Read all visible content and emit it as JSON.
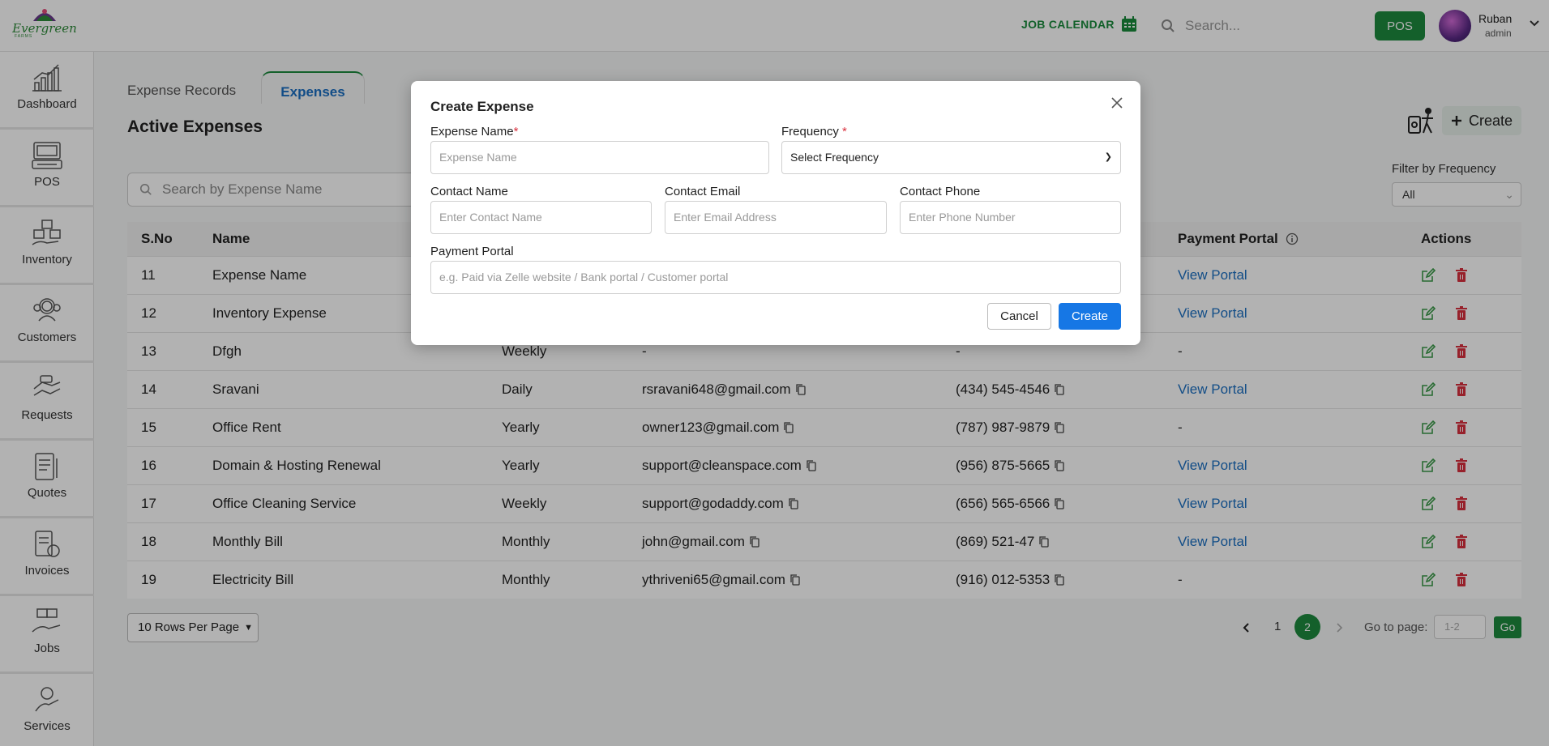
{
  "brand": {
    "name": "Evergreen",
    "sub": "FARMS"
  },
  "topbar": {
    "job_calendar": "JOB CALENDAR",
    "search_placeholder": "Search...",
    "pos_label": "POS",
    "user_name": "Ruban",
    "user_role": "admin"
  },
  "sidebar": {
    "items": [
      {
        "label": "Dashboard",
        "icon": "dashboard-icon"
      },
      {
        "label": "POS",
        "icon": "pos-icon"
      },
      {
        "label": "Inventory",
        "icon": "inventory-icon"
      },
      {
        "label": "Customers",
        "icon": "customers-icon"
      },
      {
        "label": "Requests",
        "icon": "requests-icon"
      },
      {
        "label": "Quotes",
        "icon": "quotes-icon"
      },
      {
        "label": "Invoices",
        "icon": "invoices-icon"
      },
      {
        "label": "Jobs",
        "icon": "jobs-icon"
      },
      {
        "label": "Services",
        "icon": "services-icon"
      }
    ]
  },
  "tabs": {
    "records": "Expense Records",
    "expenses": "Expenses"
  },
  "page_title": "Active Expenses",
  "search_placeholder": "Search by Expense Name",
  "create_label": "Create",
  "filter": {
    "label": "Filter by Frequency",
    "value": "All"
  },
  "table": {
    "headers": {
      "sno": "S.No",
      "name": "Name",
      "portal": "Payment Portal",
      "actions": "Actions"
    },
    "rows": [
      {
        "sno": "11",
        "name": "Expense Name",
        "freq": "",
        "email": "",
        "phone": "",
        "portal": "View Portal"
      },
      {
        "sno": "12",
        "name": "Inventory Expense",
        "freq": "",
        "email": "",
        "phone": "",
        "portal": "View Portal"
      },
      {
        "sno": "13",
        "name": "Dfgh",
        "freq": "Weekly",
        "email": "-",
        "phone": "-",
        "portal": "-"
      },
      {
        "sno": "14",
        "name": "Sravani",
        "freq": "Daily",
        "email": "rsravani648@gmail.com",
        "phone": "(434) 545-4546",
        "portal": "View Portal"
      },
      {
        "sno": "15",
        "name": "Office Rent",
        "freq": "Yearly",
        "email": "owner123@gmail.com",
        "phone": "(787) 987-9879",
        "portal": "-"
      },
      {
        "sno": "16",
        "name": "Domain & Hosting Renewal",
        "freq": "Yearly",
        "email": "support@cleanspace.com",
        "phone": "(956) 875-5665",
        "portal": "View Portal"
      },
      {
        "sno": "17",
        "name": "Office Cleaning Service",
        "freq": "Weekly",
        "email": "support@godaddy.com",
        "phone": "(656) 565-6566",
        "portal": "View Portal"
      },
      {
        "sno": "18",
        "name": "Monthly Bill",
        "freq": "Monthly",
        "email": "john@gmail.com",
        "phone": "(869) 521-47",
        "portal": "View Portal"
      },
      {
        "sno": "19",
        "name": "Electricity Bill",
        "freq": "Monthly",
        "email": "ythriveni65@gmail.com",
        "phone": "(916) 012-5353",
        "portal": "-"
      }
    ]
  },
  "pagination": {
    "rows_per_page": "10 Rows Per Page",
    "pages": [
      "1",
      "2"
    ],
    "current": "2",
    "goto_label": "Go to page:",
    "goto_placeholder": "1-2",
    "go_label": "Go"
  },
  "modal": {
    "title": "Create Expense",
    "expense_name_label": "Expense Name",
    "expense_name_placeholder": "Expense Name",
    "frequency_label": "Frequency",
    "frequency_value": "Select Frequency",
    "contact_name_label": "Contact Name",
    "contact_name_placeholder": "Enter Contact Name",
    "contact_email_label": "Contact Email",
    "contact_email_placeholder": "Enter Email Address",
    "contact_phone_label": "Contact Phone",
    "contact_phone_placeholder": "Enter Phone Number",
    "payment_portal_label": "Payment Portal",
    "payment_portal_placeholder": "e.g. Paid via Zelle website / Bank portal / Customer portal",
    "cancel_label": "Cancel",
    "create_label": "Create",
    "required_mark": "*"
  },
  "colors": {
    "brand_green": "#1d8a3e",
    "link_blue": "#1b6fc2",
    "primary_blue": "#1677e5",
    "danger_red": "#d9303e"
  }
}
